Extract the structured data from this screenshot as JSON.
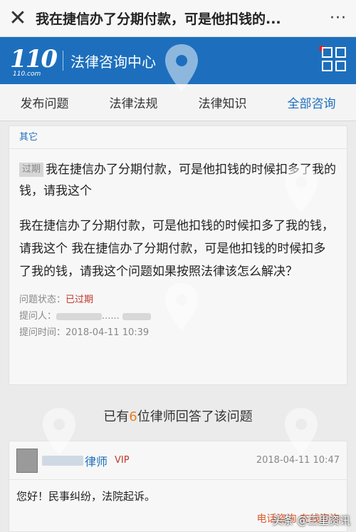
{
  "topbar": {
    "close_glyph": "✕",
    "title": "我在捷信办了分期付款，可是他扣钱的...",
    "more_glyph": "···"
  },
  "brand": {
    "logo_text": "110",
    "logo_sub": "110.com",
    "name": "法律咨询中心"
  },
  "tabs": [
    {
      "label": "发布问题"
    },
    {
      "label": "法律法规"
    },
    {
      "label": "法律知识"
    },
    {
      "label": "全部咨询",
      "active": true
    }
  ],
  "question": {
    "category": "其它",
    "badge": "过期",
    "title": "我在捷信办了分期付款，可是他扣钱的时候扣多了我的钱，请我这个",
    "body": "我在捷信办了分期付款，可是他扣钱的时候扣多了我的钱，请我这个 我在捷信办了分期付款，可是他扣钱的时候扣多了我的钱，请我这个问题如果按照法律该怎么解决？",
    "status_label": "问题状态：",
    "status_value": "已过期",
    "asker_label": "提问人：",
    "asker_value": "......",
    "time_label": "提问时间：",
    "time_value": "2018-04-11 10:39"
  },
  "answers_summary": {
    "prefix": "已有",
    "count": "6",
    "suffix": "位律师回答了该问题"
  },
  "answer": {
    "lawyer_suffix": "律师",
    "vip": "VIP",
    "time": "2018-04-11 10:47",
    "text": "您好！民事纠纷，法院起诉。",
    "links": "电话咨询  在线咨询"
  },
  "watermark": "头条 @三里资讯",
  "colors": {
    "brand_blue": "#1d6fbd",
    "expired_red": "#c0392b",
    "count_orange": "#e67e22"
  }
}
